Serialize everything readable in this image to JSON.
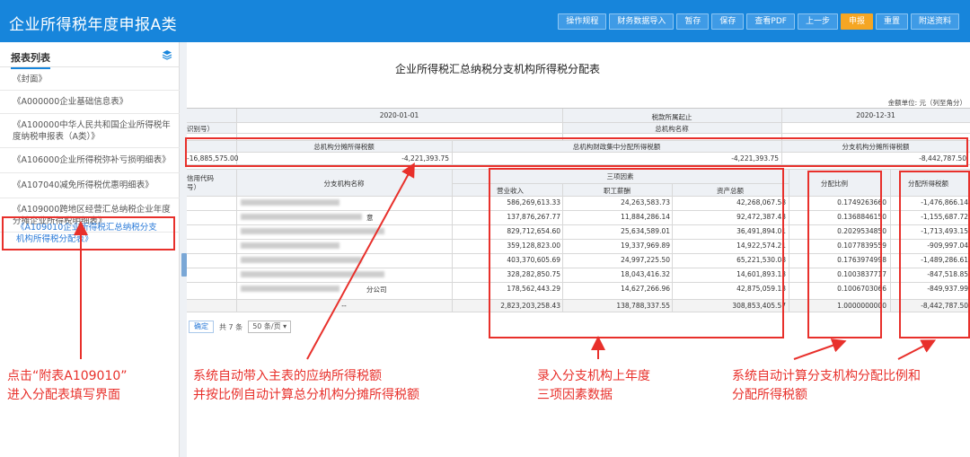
{
  "app": {
    "title": "企业所得税年度申报A类",
    "toolbar": [
      {
        "label": "操作规程",
        "highlight": false
      },
      {
        "label": "财务数据导入",
        "highlight": false
      },
      {
        "label": "暂存",
        "highlight": false
      },
      {
        "label": "保存",
        "highlight": false
      },
      {
        "label": "查看PDF",
        "highlight": false
      },
      {
        "label": "上一步",
        "highlight": false
      },
      {
        "label": "申报",
        "highlight": true
      },
      {
        "label": "重置",
        "highlight": false
      },
      {
        "label": "附送资料",
        "highlight": false
      }
    ]
  },
  "sidebar": {
    "title": "报表列表",
    "items": [
      {
        "label": "《封面》",
        "active": false
      },
      {
        "label": "《A000000企业基础信息表》",
        "active": false
      },
      {
        "label": "《A100000中华人民共和国企业所得税年度纳税申报表（A类）》",
        "active": false
      },
      {
        "label": "《A106000企业所得税弥补亏损明细表》",
        "active": false
      },
      {
        "label": "《A107040减免所得税优惠明细表》",
        "active": false
      },
      {
        "label": "《A109000跨地区经营汇总纳税企业年度分摊企业所得税明细表》",
        "active": false
      },
      {
        "label": "《A109010企业所得税汇总纳税分支机构所得税分配表》",
        "active": true
      }
    ]
  },
  "document": {
    "title": "企业所得税汇总纳税分支机构所得税分配表",
    "unit": "金额单位: 元（列至角分）",
    "period_start": "2020-01-01",
    "period_label": "税款所属起止",
    "period_end": "2020-12-31",
    "taxpayer_id_label": "识别号）",
    "head_name_label": "总机构名称",
    "totals_headers": {
      "payable": "总机构分摊所得税额",
      "central": "总机构财政集中分配所得税额",
      "branch": "分支机构分摊所得税额"
    },
    "totals_values": {
      "left": "-16,885,575.00",
      "payable": "-4,221,393.75",
      "central": "-4,221,393.75",
      "branch": "-8,442,787.50"
    },
    "columns": {
      "credit_code": "信用代码",
      "credit_code_2": "号）",
      "branch_name": "分支机构名称",
      "three_factors": "三项因素",
      "revenue": "营业收入",
      "wages": "职工薪酬",
      "assets": "资产总额",
      "ratio": "分配比例",
      "tax": "分配所得税额"
    },
    "rows": [
      {
        "name_suffix": "",
        "revenue": "586,269,613.33",
        "wages": "24,263,583.73",
        "assets": "42,268,067.58",
        "ratio": "0.1749263660",
        "tax": "-1,476,866.14"
      },
      {
        "name_suffix": "意",
        "revenue": "137,876,267.77",
        "wages": "11,884,286.14",
        "assets": "92,472,387.43",
        "ratio": "0.1368846150",
        "tax": "-1,155,687.72"
      },
      {
        "name_suffix": "",
        "revenue": "829,712,654.60",
        "wages": "25,634,589.01",
        "assets": "36,491,894.01",
        "ratio": "0.2029534850",
        "tax": "-1,713,493.15"
      },
      {
        "name_suffix": "",
        "revenue": "359,128,823.00",
        "wages": "19,337,969.89",
        "assets": "14,922,574.21",
        "ratio": "0.1077839559",
        "tax": "-909,997.04"
      },
      {
        "name_suffix": "",
        "revenue": "403,370,605.69",
        "wages": "24,997,225.50",
        "assets": "65,221,530.08",
        "ratio": "0.1763974998",
        "tax": "-1,489,286.61"
      },
      {
        "name_suffix": "",
        "revenue": "328,282,850.75",
        "wages": "18,043,416.32",
        "assets": "14,601,893.13",
        "ratio": "0.1003837717",
        "tax": "-847,518.85"
      },
      {
        "name_suffix": "分公司",
        "revenue": "178,562,443.29",
        "wages": "14,627,266.96",
        "assets": "42,875,059.13",
        "ratio": "0.1006703066",
        "tax": "-849,937.99"
      }
    ],
    "total_row": {
      "name": "--",
      "revenue": "2,823,203,258.43",
      "wages": "138,788,337.55",
      "assets": "308,853,405.57",
      "ratio": "1.0000000000",
      "tax": "-8,442,787.50"
    }
  },
  "pager": {
    "ok_label": "确定",
    "count": "共 7 条",
    "page_size": "50 条/页"
  },
  "annotations": {
    "left_1": "点击“附表A109010”",
    "left_2": "进入分配表填写界面",
    "mid_1": "系统自动带入主表的应纳所得税额",
    "mid_2": "并按比例自动计算总分机构分摊所得税额",
    "right_1": "录入分支机构上年度",
    "right_2": "三项因素数据",
    "far_1": "系统自动计算分支机构分配比例和",
    "far_2": "分配所得税额"
  },
  "colors": {
    "header": "#1785db",
    "annotation": "#e8302b",
    "highlight_button": "#f5a623"
  }
}
